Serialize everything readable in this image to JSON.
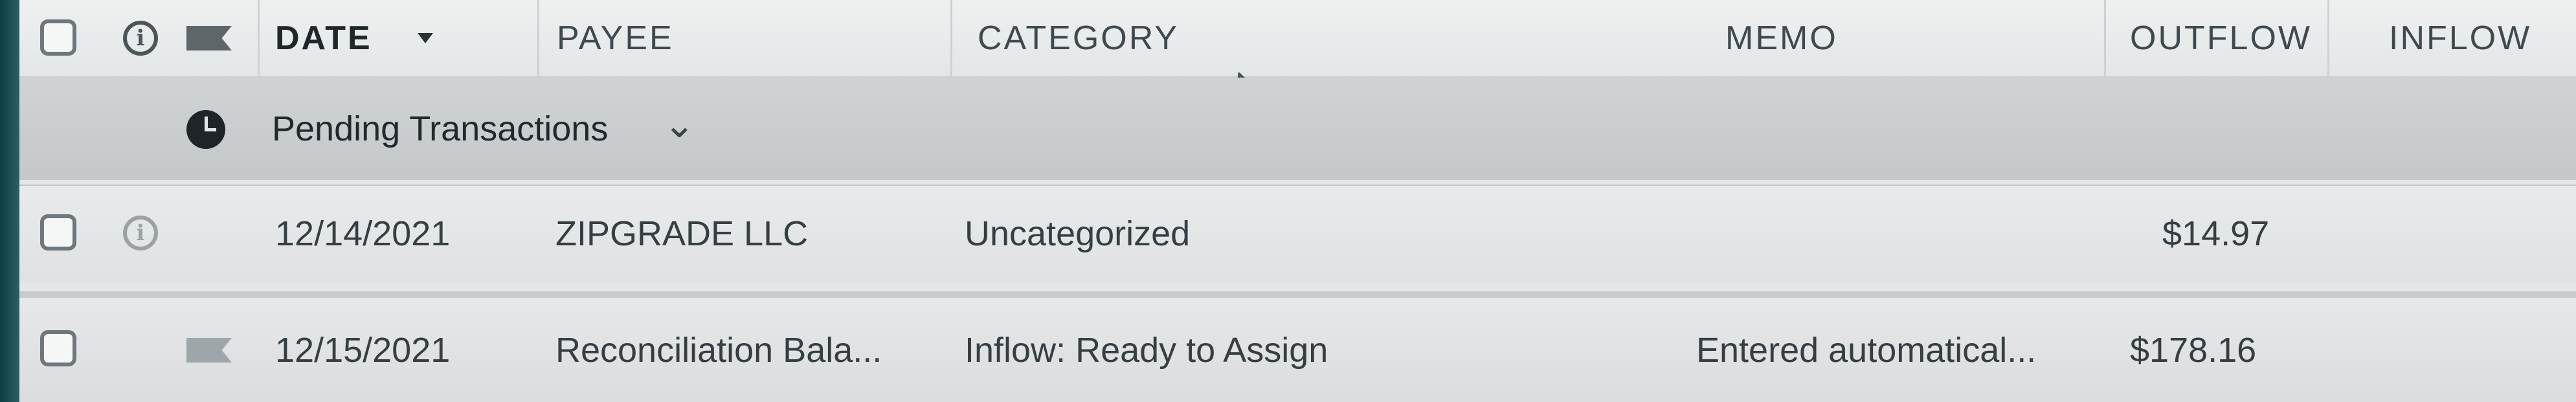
{
  "columns": {
    "date": "DATE",
    "payee": "PAYEE",
    "category": "CATEGORY",
    "memo": "MEMO",
    "outflow": "OUTFLOW",
    "inflow": "INFLOW"
  },
  "pending": {
    "label": "Pending Transactions",
    "icon": "clock-icon"
  },
  "transactions": [
    {
      "date": "12/14/2021",
      "payee": "ZIPGRADE LLC",
      "category": "Uncategorized",
      "memo": "",
      "outflow": "$14.97",
      "inflow": ""
    },
    {
      "date": "12/15/2021",
      "payee": "Reconciliation Bala...",
      "category": "Inflow: Ready to Assign",
      "memo": "Entered automatical...",
      "outflow": "$178.16",
      "inflow": ""
    }
  ],
  "colors": {
    "header_bg": "#e9ecec",
    "pending_bg": "#c8cccd",
    "text": "#2b3338"
  }
}
